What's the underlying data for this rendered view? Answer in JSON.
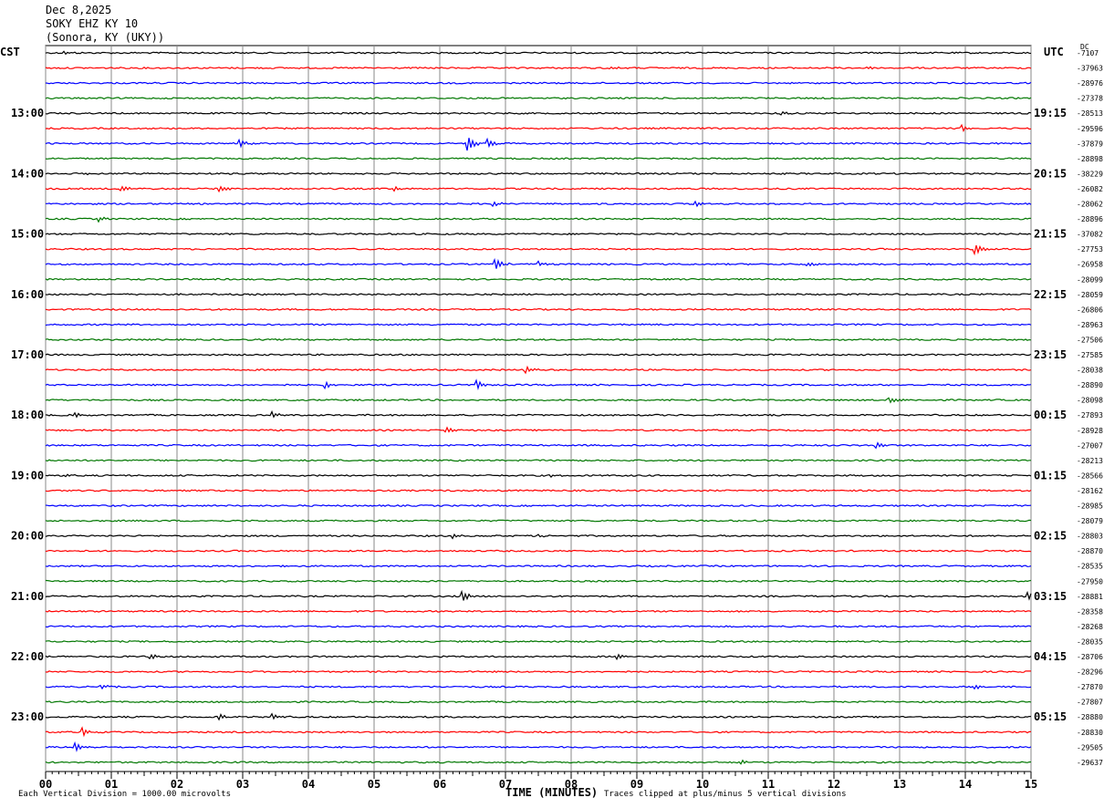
{
  "header": {
    "date": "Dec 8,2025",
    "station": "SOKY EHZ KY 10",
    "location": "(Sonora, KY (UKY))"
  },
  "left_tz": "CST",
  "right_tz": "UTC",
  "dc_label": "DC",
  "footer": {
    "scale_note": "Each Vertical Division = 1000.00 microvolts",
    "xlabel": "TIME (MINUTES)",
    "clip_note": "Traces clipped at plus/minus 5 vertical divisions"
  },
  "chart_data": {
    "type": "line",
    "title": "SOKY EHZ KY 10",
    "xlabel": "TIME (MINUTES)",
    "x_ticks": [
      "00",
      "01",
      "02",
      "03",
      "04",
      "05",
      "06",
      "07",
      "08",
      "09",
      "10",
      "11",
      "12",
      "13",
      "14",
      "15"
    ],
    "xlim": [
      0,
      15
    ],
    "trace_colors": [
      "#000000",
      "#ff0000",
      "#0000ff",
      "#007700"
    ],
    "left_time_labels": [
      "13:00",
      "14:00",
      "15:00",
      "16:00",
      "17:00",
      "18:00",
      "19:00",
      "20:00",
      "21:00",
      "22:00",
      "23:00"
    ],
    "right_time_labels": [
      "19:15",
      "20:15",
      "21:15",
      "22:15",
      "23:15",
      "00:15",
      "01:15",
      "02:15",
      "03:15",
      "04:15",
      "05:15"
    ],
    "dc_offsets": [
      "-7107",
      "-37963",
      "-28976",
      "-27378",
      "-28513",
      "-29596",
      "-37879",
      "-28898",
      "-38229",
      "-26082",
      "-28062",
      "-28896",
      "-37082",
      "-27753",
      "-26958",
      "-28099",
      "-28059",
      "-26806",
      "-28963",
      "-27506",
      "-27585",
      "-28038",
      "-28890",
      "-28098",
      "-27893",
      "-28928",
      "-27007",
      "-28213",
      "-28566",
      "-28162",
      "-28985",
      "-28079",
      "-28803",
      "-28870",
      "-28535",
      "-27950",
      "-28881",
      "-28358",
      "-28268",
      "-28035",
      "-28706",
      "-28296",
      "-27870",
      "-27807",
      "-28880",
      "-28830",
      "-29505",
      "-29637"
    ],
    "events": [
      {
        "trace": 0,
        "minute": 0.28,
        "amp": 0.6
      },
      {
        "trace": 1,
        "minute": 8.6,
        "amp": 0.4
      },
      {
        "trace": 1,
        "minute": 12.5,
        "amp": 0.3
      },
      {
        "trace": 4,
        "minute": 11.2,
        "amp": 0.5
      },
      {
        "trace": 5,
        "minute": 13.95,
        "amp": 1.0
      },
      {
        "trace": 6,
        "minute": 2.95,
        "amp": 1.0
      },
      {
        "trace": 6,
        "minute": 6.42,
        "amp": 2.2
      },
      {
        "trace": 6,
        "minute": 6.72,
        "amp": 1.1
      },
      {
        "trace": 8,
        "minute": 0.65,
        "amp": 0.4
      },
      {
        "trace": 9,
        "minute": 1.15,
        "amp": 0.8
      },
      {
        "trace": 9,
        "minute": 2.65,
        "amp": 0.8
      },
      {
        "trace": 9,
        "minute": 5.3,
        "amp": 0.6
      },
      {
        "trace": 10,
        "minute": 6.8,
        "amp": 0.8
      },
      {
        "trace": 10,
        "minute": 9.9,
        "amp": 0.8
      },
      {
        "trace": 11,
        "minute": 0.8,
        "amp": 0.8
      },
      {
        "trace": 13,
        "minute": 14.15,
        "amp": 1.6
      },
      {
        "trace": 14,
        "minute": 6.85,
        "amp": 1.6
      },
      {
        "trace": 14,
        "minute": 7.5,
        "amp": 0.8
      },
      {
        "trace": 14,
        "minute": 11.6,
        "amp": 0.5
      },
      {
        "trace": 21,
        "minute": 7.3,
        "amp": 1.0
      },
      {
        "trace": 22,
        "minute": 4.25,
        "amp": 1.1
      },
      {
        "trace": 22,
        "minute": 6.55,
        "amp": 1.5
      },
      {
        "trace": 23,
        "minute": 12.85,
        "amp": 0.8
      },
      {
        "trace": 24,
        "minute": 0.45,
        "amp": 0.6
      },
      {
        "trace": 24,
        "minute": 3.45,
        "amp": 1.0
      },
      {
        "trace": 25,
        "minute": 6.1,
        "amp": 0.7
      },
      {
        "trace": 26,
        "minute": 12.65,
        "amp": 0.9
      },
      {
        "trace": 28,
        "minute": 0.3,
        "amp": 0.5
      },
      {
        "trace": 28,
        "minute": 7.7,
        "amp": 0.4
      },
      {
        "trace": 32,
        "minute": 6.2,
        "amp": 0.8
      },
      {
        "trace": 32,
        "minute": 7.5,
        "amp": 0.4
      },
      {
        "trace": 36,
        "minute": 6.35,
        "amp": 1.3
      },
      {
        "trace": 36,
        "minute": 14.95,
        "amp": 1.3
      },
      {
        "trace": 40,
        "minute": 1.6,
        "amp": 0.6
      },
      {
        "trace": 40,
        "minute": 8.7,
        "amp": 0.6
      },
      {
        "trace": 42,
        "minute": 0.85,
        "amp": 0.6
      },
      {
        "trace": 42,
        "minute": 14.15,
        "amp": 0.6
      },
      {
        "trace": 44,
        "minute": 2.65,
        "amp": 0.7
      },
      {
        "trace": 44,
        "minute": 3.45,
        "amp": 0.9
      },
      {
        "trace": 45,
        "minute": 0.55,
        "amp": 1.6
      },
      {
        "trace": 46,
        "minute": 0.45,
        "amp": 1.2
      },
      {
        "trace": 47,
        "minute": 10.6,
        "amp": 0.6
      }
    ]
  }
}
